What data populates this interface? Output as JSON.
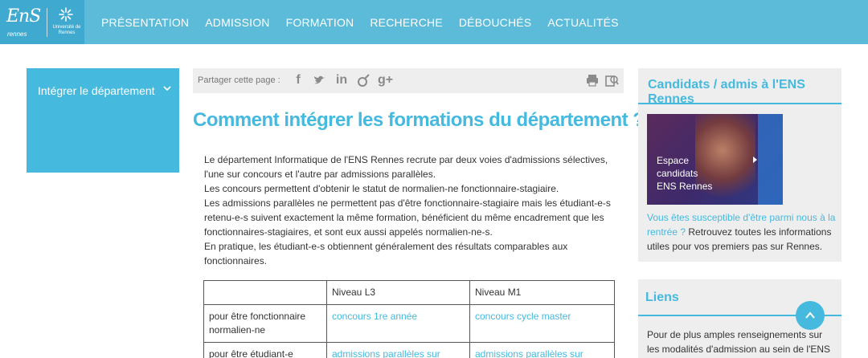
{
  "header": {
    "logo_ens": "EnS",
    "logo_rennes": "rennes",
    "logo_univ": "Université de Rennes",
    "nav": [
      "PRÉSENTATION",
      "ADMISSION",
      "FORMATION",
      "RECHERCHE",
      "DÉBOUCHÉS",
      "ACTUALITÉS"
    ]
  },
  "sidebar": {
    "menu_label": "Intégrer le département"
  },
  "share": {
    "label": "Partager cette page :",
    "icons": [
      "facebook-icon",
      "twitter-icon",
      "linkedin-icon",
      "viadeo-icon",
      "google-plus-icon"
    ],
    "facebook": "f",
    "twitter": "t",
    "linkedin": "in",
    "viadeo": "v",
    "google_plus": "g+"
  },
  "main": {
    "title": "Comment intégrer les formations du département ?",
    "paragraphs": [
      "Le département Informatique de l'ENS Rennes recrute par deux voies d'admissions sélectives, l'une sur concours et l'autre par admissions parallèles.",
      "Les concours permettent d'obtenir le statut de normalien-ne fonctionnaire-stagiaire.",
      "Les admissions parallèles ne permettent pas d'être fonctionnaire-stagiaire  mais les étudiant-e-s retenu-e-s suivent exactement la même formation, bénéficient du même encadrement que les fonctionnaires-stagiaires, et sont eux aussi appelés normalien-ne-s.",
      "En pratique, les étudiant-e-s obtiennent généralement des résultats comparables aux fonctionnaires."
    ],
    "table": {
      "headers": [
        "",
        "Niveau L3",
        "Niveau M1"
      ],
      "rows": [
        [
          "pour être fonctionnaire normalien-ne",
          "concours 1re année",
          "concours cycle master"
        ],
        [
          "pour être étudiant-e",
          "admissions parallèles sur",
          "admissions parallèles sur"
        ]
      ]
    }
  },
  "right": {
    "title": "Candidats / admis à l'ENS Rennes",
    "promo_line1": "Espace",
    "promo_line2": "candidats",
    "promo_line3": "ENS Rennes",
    "link_text": "Vous êtes susceptible d'être parmi nous à la rentrée ?",
    "desc_text": " Retrouvez toutes les informations utiles pour vos premiers pas sur Rennes.",
    "liens_title": "Liens",
    "liens_text": "Pour de plus amples renseignements sur les modalités d'admission au sein de l'ENS"
  },
  "colors": {
    "accent": "#45b9de",
    "header_bg": "#5bbbd8",
    "panel_bg": "#eeeeee"
  }
}
